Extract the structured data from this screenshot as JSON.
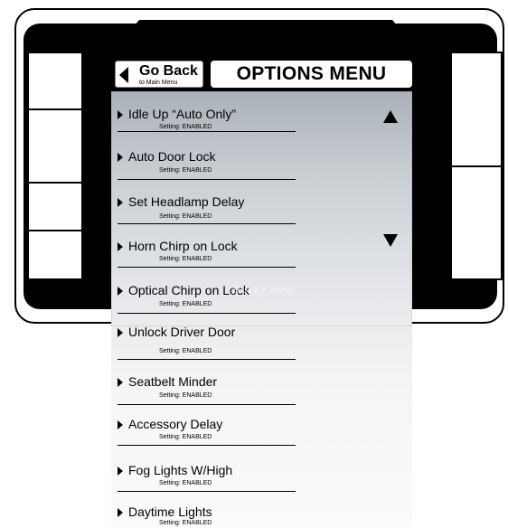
{
  "header": {
    "go_back_label": "Go Back",
    "go_back_sub": "to Main Menu",
    "title": "OPTIONS MENU"
  },
  "menu": {
    "items": [
      {
        "name": "Idle Up “Auto Only”",
        "setting": "Setting:    ENABLED"
      },
      {
        "name": "Auto Door Lock",
        "setting": "Setting:    ENABLED"
      },
      {
        "name": "Set Headlamp Delay",
        "setting": "Setting:    ENABLED"
      },
      {
        "name": "Horn Chirp on Lock",
        "setting": "Setting:    ENABLED"
      },
      {
        "name": "Optical Chirp on Lock",
        "setting": "Setting:    ENABLED"
      },
      {
        "name": "Unlock Driver Door",
        "setting": "Setting:    ENABLED"
      },
      {
        "name": "Seatbelt Minder",
        "setting": "Setting:    ENABLED"
      },
      {
        "name": "Accessory Delay",
        "setting": "Setting:    ENABLED"
      },
      {
        "name": "Fog Lights W/High",
        "setting": "Setting:    ENABLED"
      },
      {
        "name": "Daytime Lights",
        "setting": "Setting:    ENABLED"
      }
    ]
  },
  "watermark": "BULLY DOG",
  "icons": {
    "back": "triangle-left-icon",
    "scroll_up": "triangle-up-icon",
    "scroll_down": "triangle-down-icon",
    "item_bullet": "triangle-right-icon"
  },
  "colors": {
    "frame": "#000000",
    "panel_top": "#aab1b8",
    "panel_bottom": "#fbfbfb"
  }
}
